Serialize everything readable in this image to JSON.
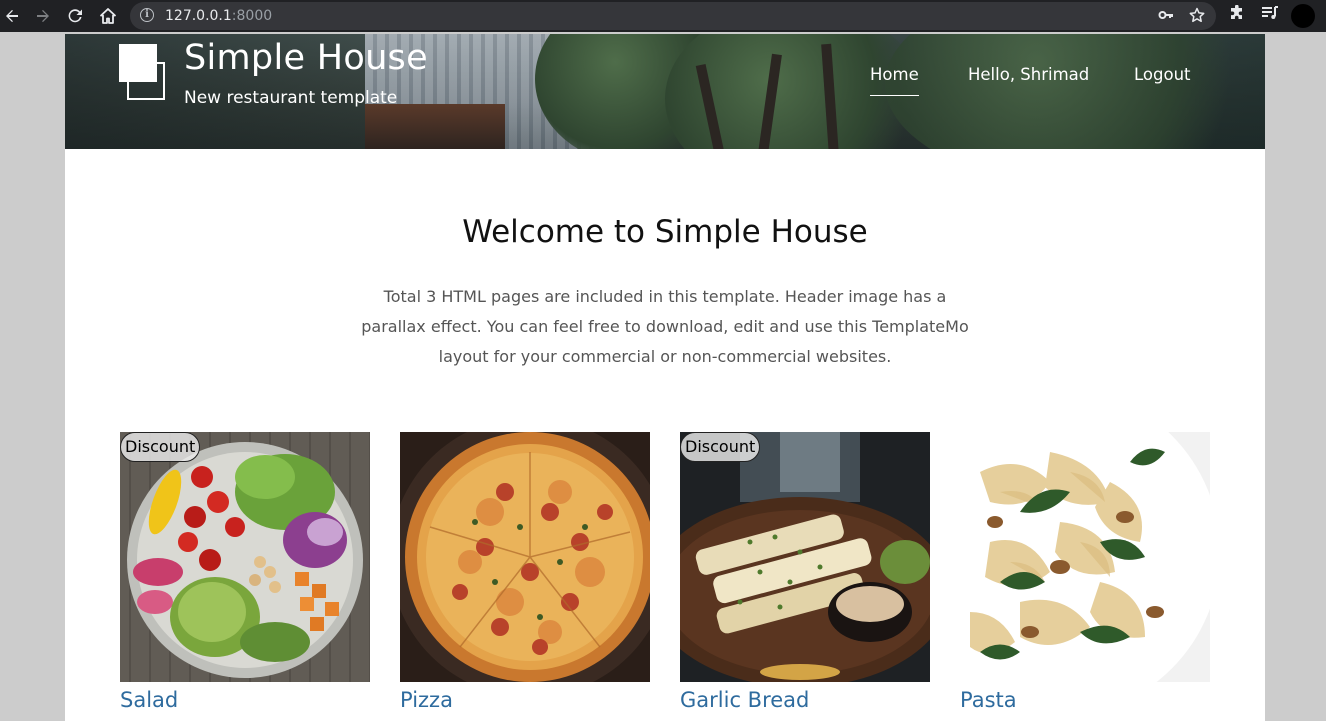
{
  "browser": {
    "url_host": "127.0.0.1",
    "url_port": ":8000",
    "icons": [
      "back-arrow-icon",
      "forward-arrow-icon",
      "reload-icon",
      "home-icon",
      "info-icon",
      "key-icon",
      "star-icon",
      "puzzle-icon",
      "media-control-icon",
      "profile-icon"
    ]
  },
  "header": {
    "site_title": "Simple House",
    "site_subtitle": "New restaurant template",
    "nav": [
      {
        "label": "Home",
        "active": true
      },
      {
        "label": "Hello, Shrimad",
        "active": false
      },
      {
        "label": "Logout",
        "active": false
      }
    ]
  },
  "main": {
    "heading": "Welcome to Simple House",
    "intro": "Total 3 HTML pages are included in this template. Header image has a parallax effect. You can feel free to download, edit and use this TemplateMo layout for your commercial or non-commercial websites."
  },
  "menu_items": [
    {
      "name": "Salad",
      "badge": "Discount"
    },
    {
      "name": "Pizza",
      "badge": ""
    },
    {
      "name": "Garlic Bread",
      "badge": "Discount"
    },
    {
      "name": "Pasta",
      "badge": ""
    }
  ],
  "colors": {
    "link": "#2e6b9e",
    "chrome_bg": "#202124",
    "page_bg": "#cccccc"
  }
}
